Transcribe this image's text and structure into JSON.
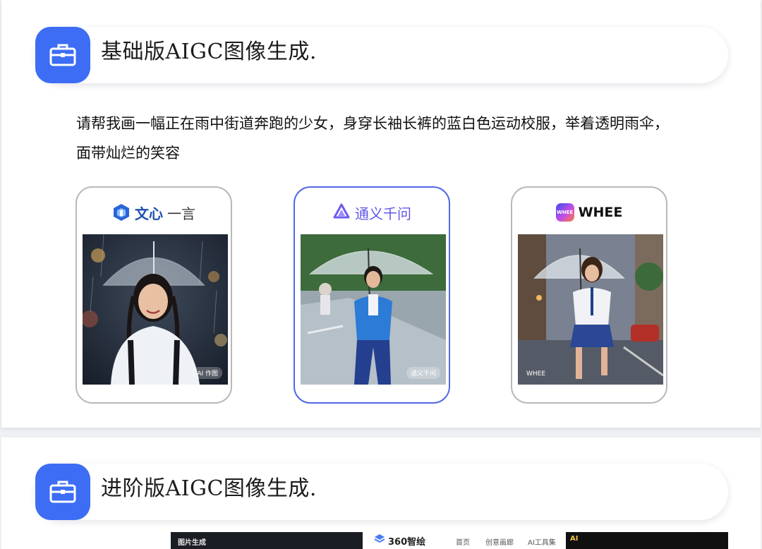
{
  "section1": {
    "title": "基础版AIGC图像生成.",
    "prompt": "请帮我画一幅正在雨中街道奔跑的少女，身穿长袖长裤的蓝白色运动校服，举着透明雨伞，面带灿烂的笑容",
    "models": [
      {
        "brand_part1": "文心",
        "brand_part2": "一言",
        "icon": "wenxin-logo-icon",
        "watermark": "AI 作图",
        "selected": false
      },
      {
        "brand": "通义千问",
        "icon": "tongyi-logo-icon",
        "watermark": "通义千问",
        "selected": true
      },
      {
        "brand": "WHEE",
        "icon": "whee-logo-icon",
        "logo_text": "WHEE",
        "watermark": "WHEE",
        "selected": false
      }
    ]
  },
  "section2": {
    "title": "进阶版AIGC图像生成.",
    "previews": {
      "left_label": "图片生成",
      "mid_brand": "360智绘",
      "mid_nav": [
        "首页",
        "创意画廊",
        "AI工具集"
      ],
      "right_logo": "AI"
    }
  },
  "colors": {
    "accent": "#3d6df5",
    "selected_border": "#5068e6",
    "card_border": "#b9b9b9",
    "page_bg": "#eef0f4"
  }
}
